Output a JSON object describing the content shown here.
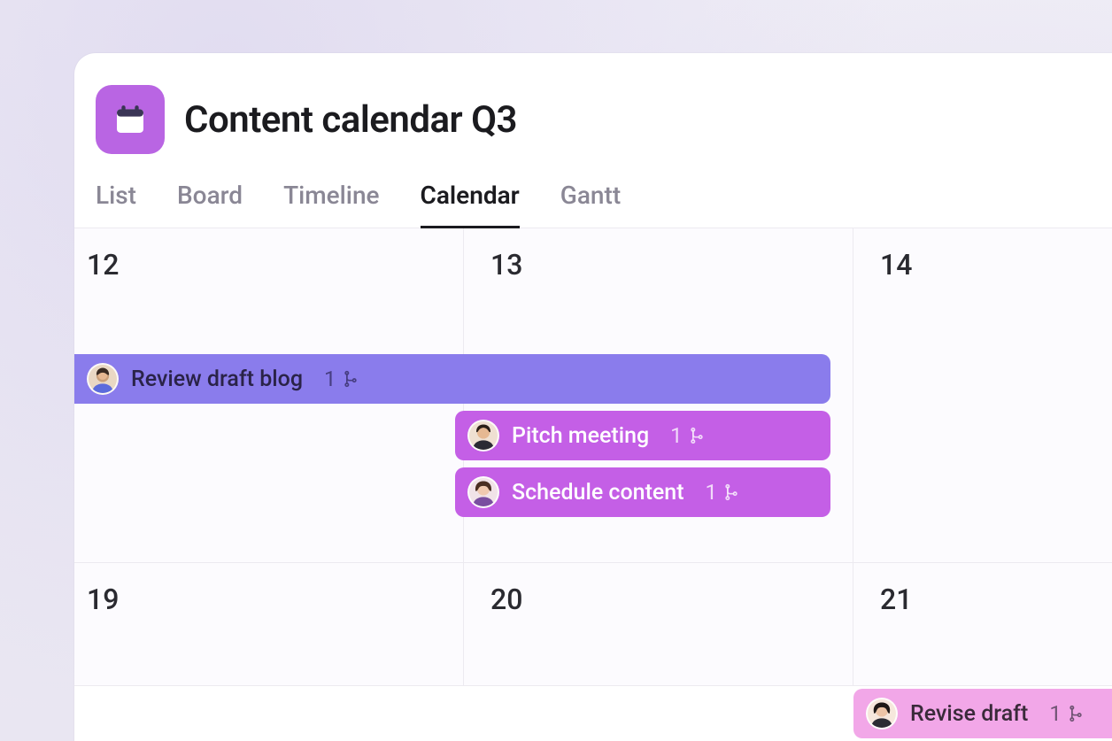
{
  "header": {
    "title": "Content calendar Q3",
    "icon": "calendar-icon"
  },
  "tabs": [
    {
      "label": "List",
      "active": false
    },
    {
      "label": "Board",
      "active": false
    },
    {
      "label": "Timeline",
      "active": false
    },
    {
      "label": "Calendar",
      "active": true
    },
    {
      "label": "Gantt",
      "active": false
    }
  ],
  "colors": {
    "project_icon_bg": "#b965e3",
    "event_indigo": "#8a7cec",
    "event_purple": "#c45fe6",
    "event_pink": "#f2a7e8"
  },
  "calendar": {
    "days": [
      {
        "num": "12"
      },
      {
        "num": "13"
      },
      {
        "num": "14"
      },
      {
        "num": "19"
      },
      {
        "num": "20"
      },
      {
        "num": "21"
      }
    ],
    "events": [
      {
        "id": "e1",
        "title": "Review draft blog",
        "subtask_count": "1",
        "color": "indigo",
        "span_from_day": "12",
        "span_to_day": "13"
      },
      {
        "id": "e2",
        "title": "Pitch meeting",
        "subtask_count": "1",
        "color": "purple",
        "day": "13"
      },
      {
        "id": "e3",
        "title": "Schedule content",
        "subtask_count": "1",
        "color": "purple",
        "day": "13"
      },
      {
        "id": "e4",
        "title": "Revise draft",
        "subtask_count": "1",
        "color": "pink",
        "day": "21"
      }
    ]
  }
}
